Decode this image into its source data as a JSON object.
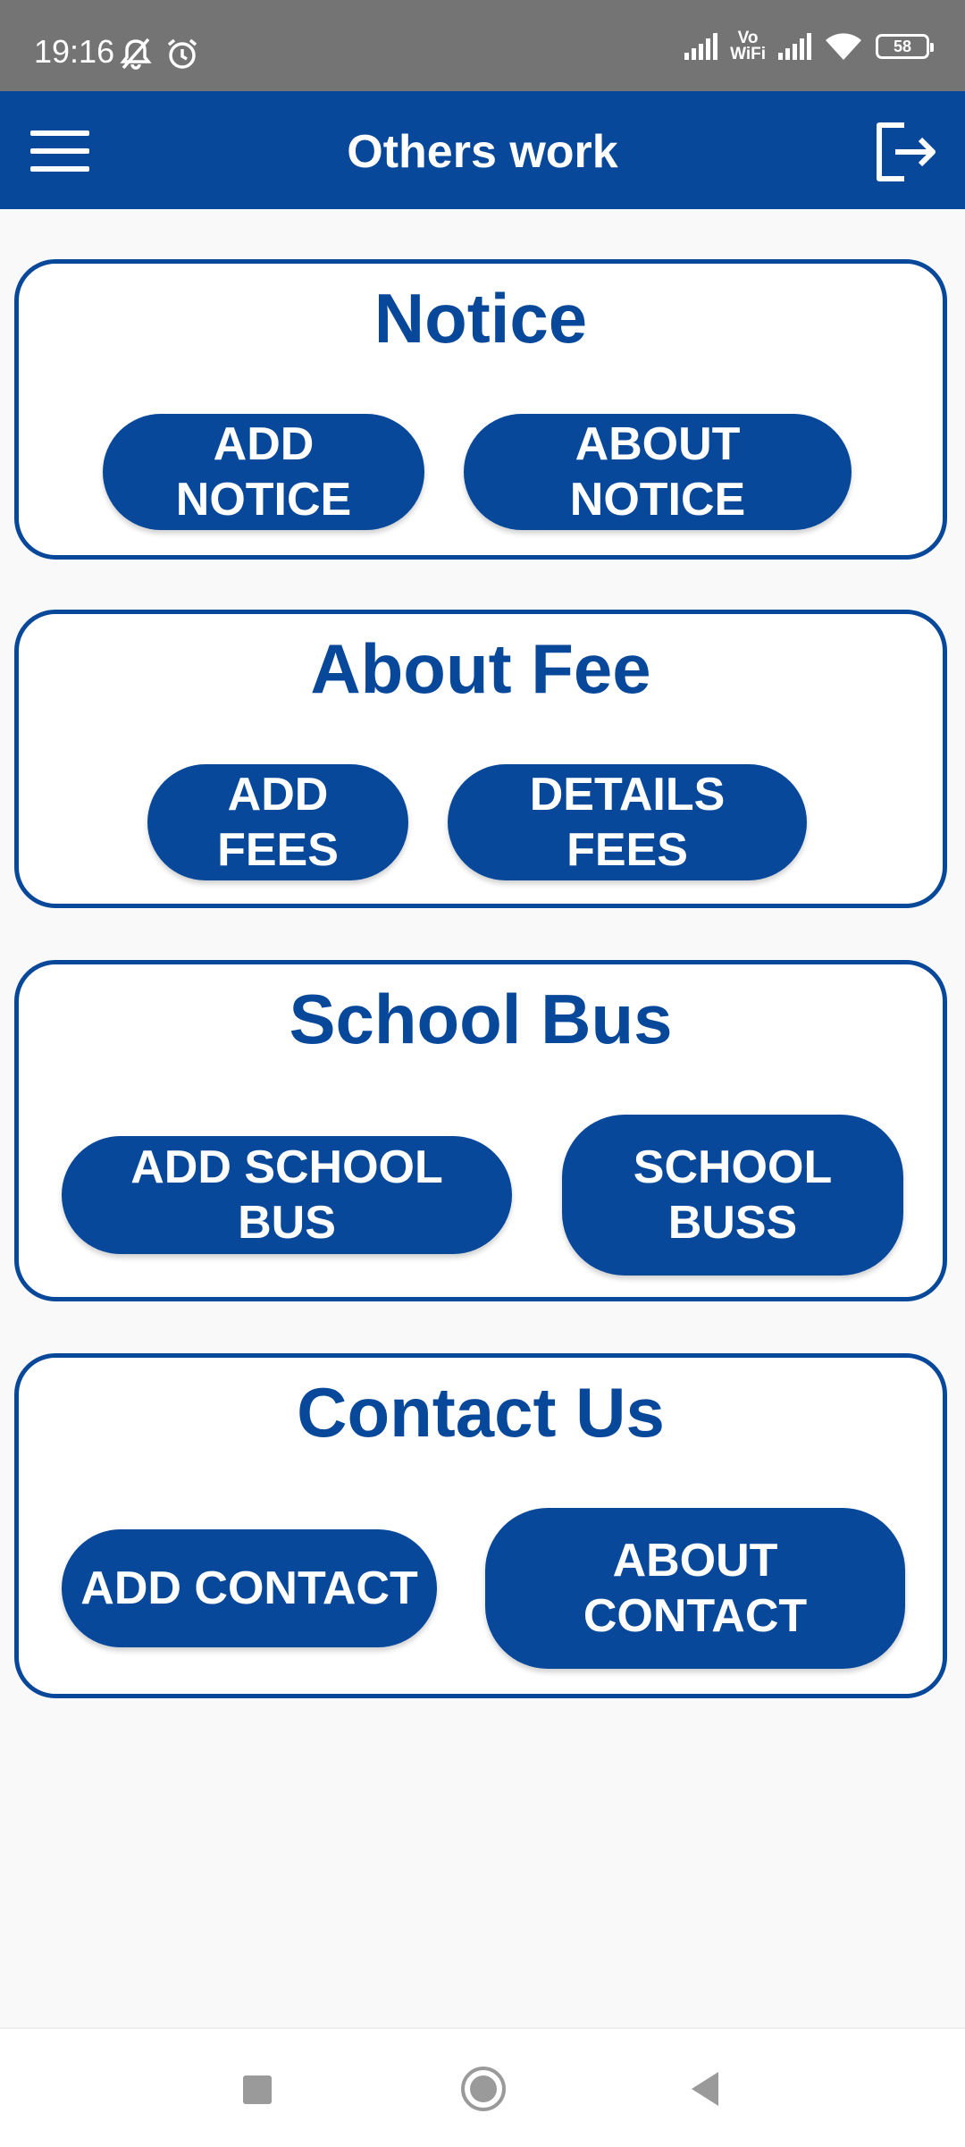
{
  "status_bar": {
    "time": "19:16",
    "vowifi_top": "Vo",
    "vowifi_bottom": "WiFi",
    "battery": "58"
  },
  "app_bar": {
    "title": "Others work"
  },
  "sections": [
    {
      "title": "Notice",
      "buttons": [
        "ADD NOTICE",
        "ABOUT NOTICE"
      ]
    },
    {
      "title": "About Fee",
      "buttons": [
        "ADD FEES",
        "DETAILS FEES"
      ]
    },
    {
      "title": "School Bus",
      "buttons": [
        "ADD SCHOOL BUS",
        "SCHOOL BUSS"
      ]
    },
    {
      "title": "Contact Us",
      "buttons": [
        "ADD CONTACT",
        "ABOUT CONTACT"
      ]
    }
  ],
  "colors": {
    "primary": "#08489a",
    "status_bar": "#747474",
    "background": "#f9f9f9"
  }
}
